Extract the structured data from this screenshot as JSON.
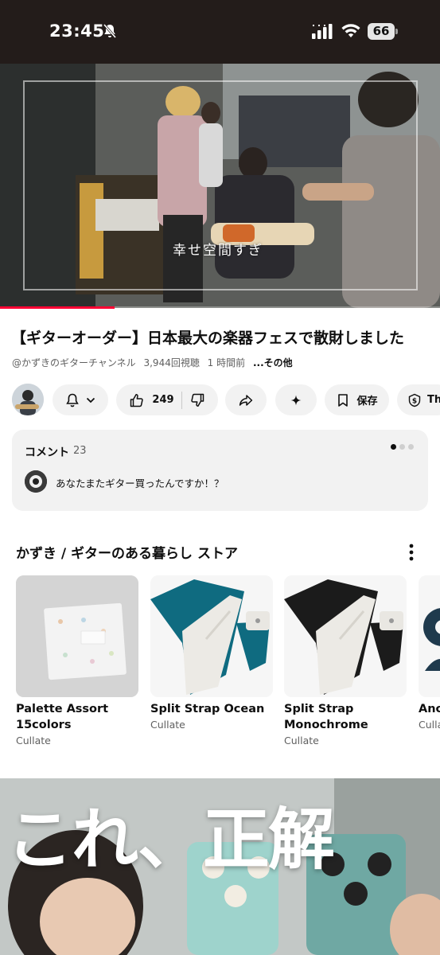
{
  "status_bar": {
    "time": "23:45",
    "battery": "66"
  },
  "video": {
    "caption": "幸せ空間すぎ",
    "progress_fraction": 0.26
  },
  "title": "【ギターオーダー】日本最大の楽器フェスで散財しました",
  "meta": {
    "channel": "@かずきのギターチャンネル",
    "views": "3,944回視聴",
    "age": "1 時間前",
    "more": "...その他"
  },
  "actions": {
    "like_count": "249",
    "save_label": "保存",
    "thanks_label": "Tha"
  },
  "comments": {
    "title": "コメント",
    "count": "23",
    "top_comment": "あなたまたギター買ったんですか！？"
  },
  "store": {
    "title": "かずき / ギターのある暮らし ストア",
    "products": [
      {
        "name_line1": "Palette Assort",
        "name_line2": "15colors",
        "brand": "Cullate"
      },
      {
        "name_line1": "Split Strap Ocean",
        "name_line2": "",
        "brand": "Cullate"
      },
      {
        "name_line1": "Split Strap",
        "name_line2": "Monochrome",
        "brand": "Cullate"
      },
      {
        "name_line1": "Anc",
        "name_line2": "",
        "brand": "Culla"
      }
    ]
  },
  "next_video": {
    "thumbnail_text": "これ、正解"
  },
  "colors": {
    "progress": "#ff0033",
    "pill_bg": "#f2f2f2",
    "strap_ocean": "#0f6b80",
    "strap_black": "#1b1b1b"
  }
}
